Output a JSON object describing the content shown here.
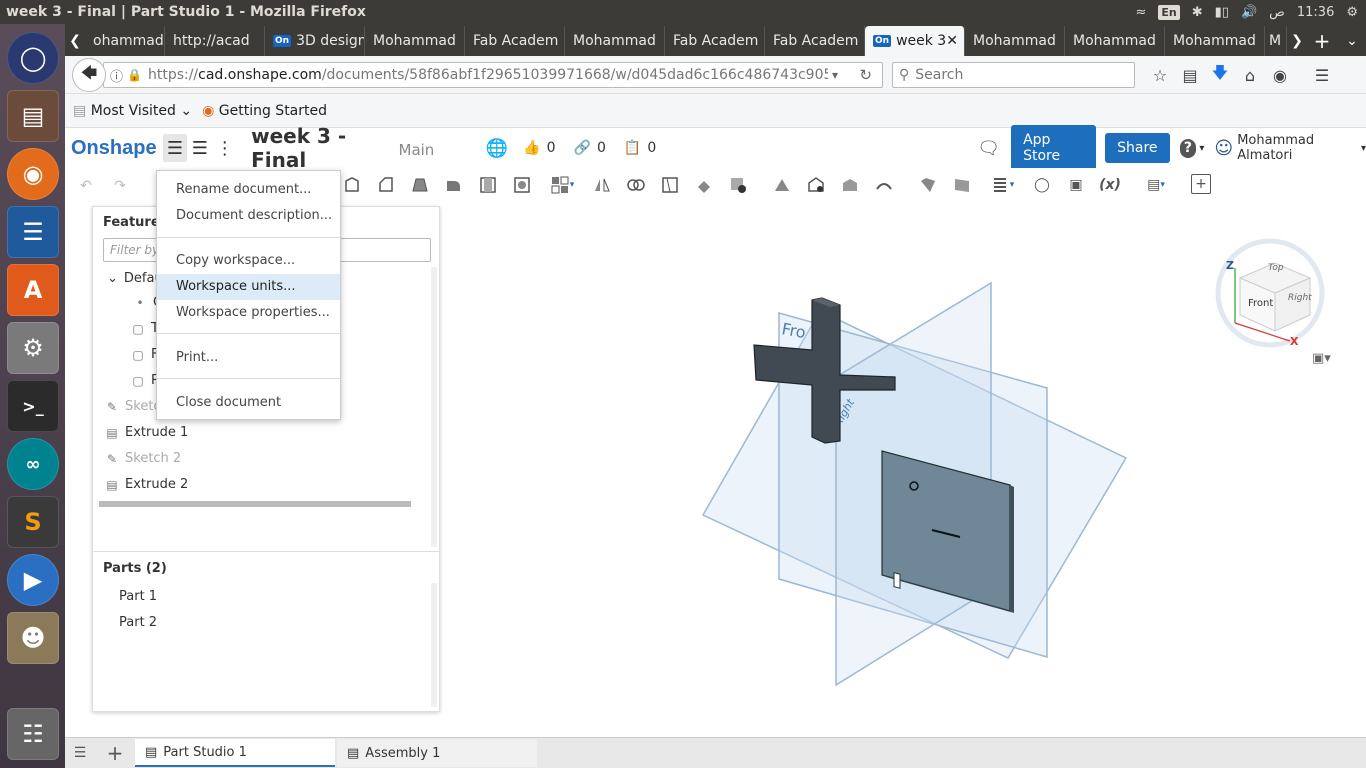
{
  "window_title": "week 3 - Final | Part Studio 1 - Mozilla Firefox",
  "tray": {
    "lang": "En",
    "clock": "11:36",
    "clock_suffix": "ص"
  },
  "launcher": [
    "Ubuntu",
    "Files",
    "Firefox",
    "Writer",
    "Software Center",
    "System Settings",
    "Terminal",
    "Arduino",
    "Sublime Text",
    "Media Player",
    "GIMP",
    "Trash"
  ],
  "tabs": [
    {
      "label": "ohammad"
    },
    {
      "label": "http://acad"
    },
    {
      "label": "3D design"
    },
    {
      "label": "Mohammad"
    },
    {
      "label": "Fab Academ"
    },
    {
      "label": "Mohammad"
    },
    {
      "label": "Fab Academ"
    },
    {
      "label": "Fab Academ"
    },
    {
      "label": "week 3"
    },
    {
      "label": "Mohammad"
    },
    {
      "label": "Mohammad"
    },
    {
      "label": "Mohammad"
    },
    {
      "label": "M"
    }
  ],
  "browser": {
    "url": "https://cad.onshape.com/documents/58f86abf1f29651039971668/w/d045dad6c166c486743c905f/e,",
    "url_host": "cad.onshape.com",
    "url_scheme": "https://",
    "url_path": "/documents/58f86abf1f29651039971668/w/d045dad6c166c486743c905f/e,",
    "search_placeholder": "Search"
  },
  "bookmarks": {
    "most_visited": "Most Visited",
    "getting_started": "Getting Started"
  },
  "onshape": {
    "logo": "Onshape",
    "doc_title": "week 3 - Final",
    "workspace": "Main",
    "likes": "0",
    "links": "0",
    "copies": "0",
    "app_store": "App Store",
    "share": "Share",
    "help": "?",
    "user": "Mohammad Almatori"
  },
  "menu": {
    "items": [
      "Rename document...",
      "Document description...",
      "Copy workspace...",
      "Workspace units...",
      "Workspace properties...",
      "Print...",
      "Close document"
    ]
  },
  "features": {
    "title": "Features",
    "filter_placeholder": "Filter by",
    "default_group": "Defau",
    "origin": "O",
    "top": "T",
    "front": "F",
    "right": "R",
    "sketch1": "Sketc",
    "extrude1": "Extrude 1",
    "sketch2": "Sketch 2",
    "extrude2": "Extrude 2",
    "parts_title": "Parts (2)",
    "part1": "Part 1",
    "part2": "Part 2"
  },
  "viewcube": {
    "top": "Top",
    "front": "Front",
    "right": "Right",
    "z": "Z",
    "x": "X"
  },
  "planes": {
    "front": "Fro",
    "right": "Right"
  },
  "bottom_tabs": {
    "part_studio": "Part Studio 1",
    "assembly": "Assembly 1"
  }
}
